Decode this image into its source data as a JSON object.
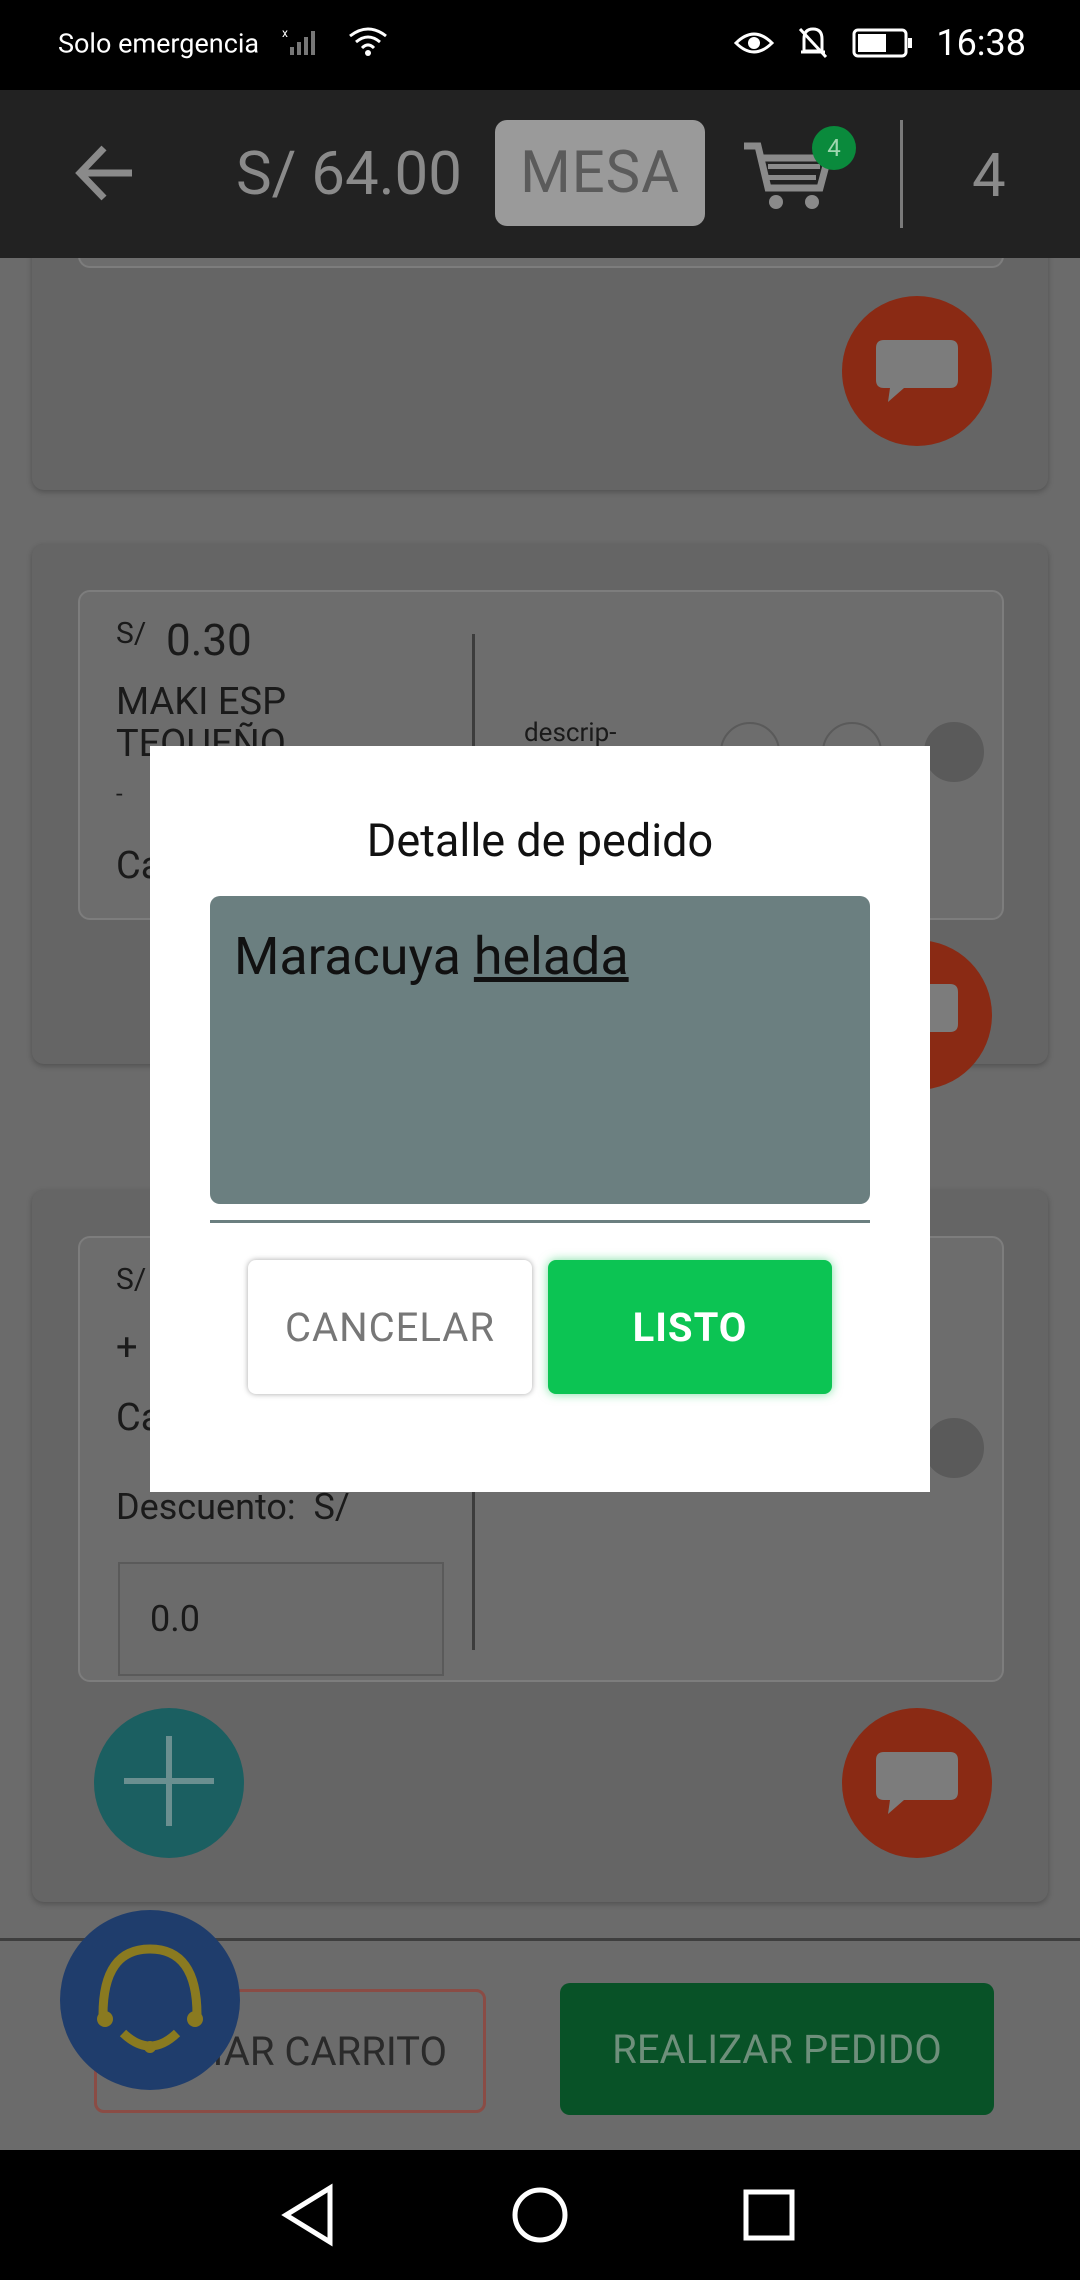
{
  "status_bar": {
    "carrier_text": "Solo emergencia",
    "time": "16:38"
  },
  "header": {
    "total": "S/ 64.00",
    "mesa_label": "MESA",
    "cart_badge": "4",
    "count": "4"
  },
  "items": [
    {
      "price_prefix": "S/",
      "price": "0.30",
      "name_line1": "MAKI ESP",
      "name_line2": "TEQUEÑO",
      "dash": "-",
      "qty_label_partial": "Ca",
      "descrip_label": "descrip-"
    },
    {
      "price_prefix": "S/",
      "plus": "+",
      "qty_label_partial": "Ca",
      "discount_label": "Descuento:  S/",
      "discount_value": "0.0"
    }
  ],
  "bottom": {
    "clear_cart": "VACIAR CARRITO",
    "place_order": "REALIZAR PEDIDO"
  },
  "dialog": {
    "title": "Detalle de pedido",
    "note_word1": "Maracuya",
    "note_word2": "helada",
    "cancel": "CANCELAR",
    "done": "LISTO"
  },
  "colors": {
    "accent_green": "#0cc453",
    "note_bg": "#6b7f80",
    "chat_orange": "#c0401b"
  },
  "icons": [
    "back-arrow-icon",
    "cart-icon",
    "chat-icon",
    "plus-icon",
    "headset-icon",
    "eye-icon",
    "bell-off-icon",
    "battery-icon",
    "wifi-icon",
    "signal-icon",
    "nav-back-icon",
    "nav-home-icon",
    "nav-recents-icon"
  ]
}
